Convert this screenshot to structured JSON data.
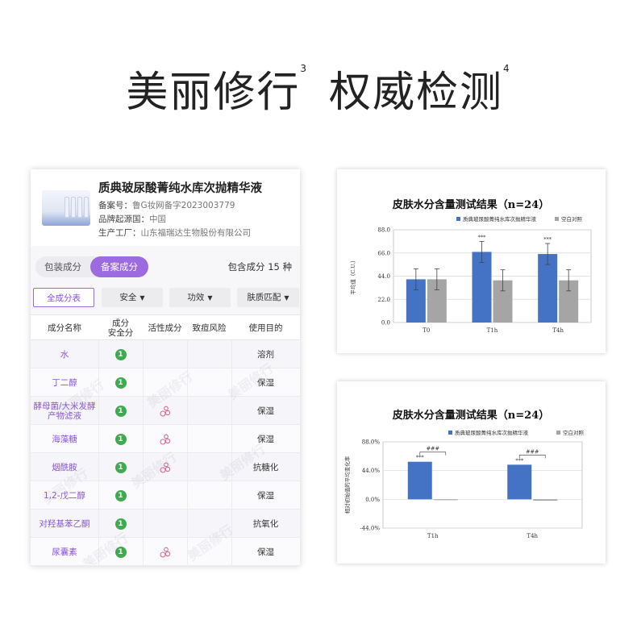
{
  "title": {
    "part1": "美丽修行",
    "sup1": "3",
    "part2": "权威检测",
    "sup2": "4"
  },
  "product": {
    "name": "质典玻尿酸菁纯水库次抛精华液",
    "record_label": "备案号：",
    "record_value": "鲁G妆网备字2023003779",
    "origin_label": "品牌起源国：",
    "origin_value": "中国",
    "factory_label": "生产工厂：",
    "factory_value": "山东福瑞达生物股份有限公司"
  },
  "tabs": {
    "a": "包装成分",
    "b": "备案成分"
  },
  "count_text": "包含成分 15 种",
  "filters": {
    "all": "全成分表",
    "safety": "安全",
    "effect": "功效",
    "skin": "肤质匹配",
    "arrow": "▼"
  },
  "table": {
    "headers": [
      "成分名称",
      "成分\n安全分",
      "活性成分",
      "致痘风险",
      "使用目的"
    ],
    "rows": [
      {
        "name": "水",
        "score": "1",
        "active": false,
        "use": "溶剂"
      },
      {
        "name": "丁二醇",
        "score": "1",
        "active": false,
        "use": "保湿"
      },
      {
        "name": "酵母菌/大米发酵产物滤液",
        "score": "1",
        "active": true,
        "use": "保湿"
      },
      {
        "name": "海藻糖",
        "score": "1",
        "active": true,
        "use": "保湿"
      },
      {
        "name": "烟酰胺",
        "score": "1",
        "active": true,
        "use": "抗糖化"
      },
      {
        "name": "1,2-戊二醇",
        "score": "1",
        "active": false,
        "use": "保湿"
      },
      {
        "name": "对羟基苯乙酮",
        "score": "1",
        "active": false,
        "use": "抗氧化"
      },
      {
        "name": "尿囊素",
        "score": "1",
        "active": true,
        "use": "保湿"
      }
    ],
    "watermark": "美丽修行"
  },
  "colors": {
    "accent": "#9b6bdf",
    "blue": "#4472c4",
    "gray": "#a5a5a5",
    "green": "#3faa4f"
  },
  "chart_data": [
    {
      "type": "bar",
      "title": "皮肤水分含量测试结果（n=24）",
      "ylabel": "平均值（C.U.）",
      "categories": [
        "T0",
        "T1h",
        "T4h"
      ],
      "series": [
        {
          "name": "质典玻尿酸菁纯水库次抛精华液",
          "values": [
            41,
            67,
            65
          ],
          "errors": [
            10,
            10,
            10
          ]
        },
        {
          "name": "空白对照",
          "values": [
            41,
            40,
            40
          ],
          "errors": [
            10,
            10,
            10
          ]
        }
      ],
      "yticks": [
        "88.0",
        "66.0",
        "44.0",
        "22.0",
        "0.0"
      ],
      "ylim": [
        0,
        88
      ],
      "annotations": [
        "***",
        "***"
      ],
      "grid": true,
      "legend": "top"
    },
    {
      "type": "bar",
      "title": "皮肤水分含量测试结果（n=24）",
      "ylabel": "相对初始值的平均变化率",
      "categories": [
        "T1h",
        "T4h"
      ],
      "series": [
        {
          "name": "质典玻尿酸菁纯水库次抛精华液",
          "values": [
            57.5,
            53
          ]
        },
        {
          "name": "空白对照",
          "values": [
            -1,
            -2
          ]
        }
      ],
      "yticks": [
        "88.0%",
        "44.0%",
        "0.0%",
        "-44.0%"
      ],
      "ylim": [
        -44,
        88
      ],
      "annotations": [
        "***",
        "###"
      ],
      "grid": true,
      "legend": "top"
    }
  ]
}
